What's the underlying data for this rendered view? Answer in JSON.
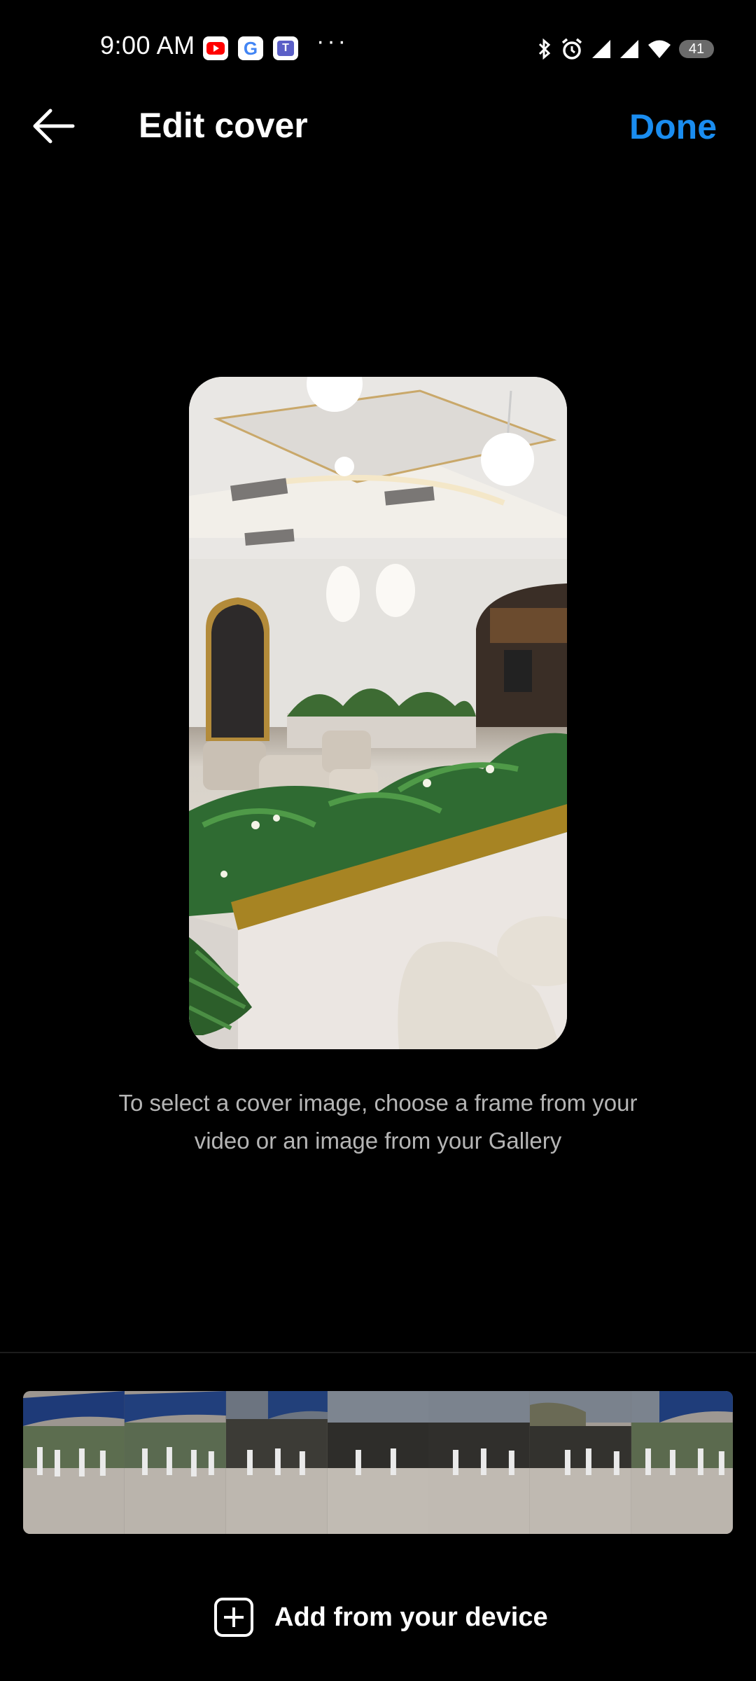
{
  "status_bar": {
    "time": "9:00 AM",
    "notification_icons": [
      "youtube-icon",
      "google-icon",
      "teams-icon"
    ],
    "more_indicator": "···",
    "battery": "41",
    "system_icons": [
      "bluetooth-icon",
      "alarm-icon",
      "signal-icon",
      "signal-icon",
      "wifi-icon"
    ]
  },
  "header": {
    "title": "Edit cover",
    "done_label": "Done",
    "back_icon": "arrow-left-icon"
  },
  "cover": {
    "description": "cafe interior with plants"
  },
  "instructions": {
    "line1": "To select a cover image, choose a frame from your",
    "line2": "video or an image from your Gallery"
  },
  "timeline": {
    "frame_count": 7
  },
  "add_device": {
    "label": "Add from your device",
    "icon": "plus-square-icon"
  },
  "colors": {
    "accent": "#1a8df0",
    "background": "#000000",
    "secondary_text": "#b5b5b5"
  }
}
